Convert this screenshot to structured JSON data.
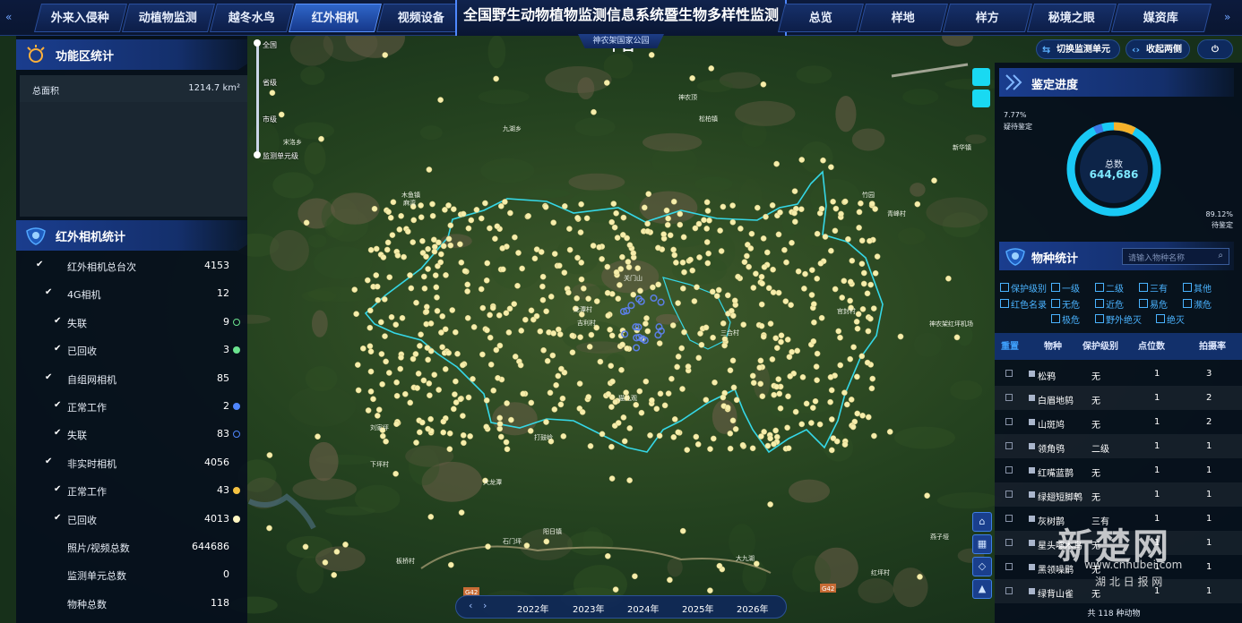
{
  "top_nav": {
    "left_tabs": [
      "外来入侵种",
      "动植物监测",
      "越冬水鸟",
      "红外相机",
      "视频设备"
    ],
    "right_tabs": [
      "总览",
      "样地",
      "样方",
      "秘境之眼",
      "媒资库"
    ],
    "active_tab": "红外相机",
    "title": "全国野生动物植物监测信息系统暨生物多样性监测平台",
    "subtitle": "神农架国家公园",
    "prev_icon": "double-chevron-left",
    "next_icon": "double-chevron-right"
  },
  "functional_zone": {
    "title": "功能区统计",
    "total_area_label": "总面积",
    "total_area_value": "1214.7 km²"
  },
  "camera_stats": {
    "title": "红外相机统计",
    "rows": [
      {
        "label": "红外相机总台次",
        "value": "4153",
        "checked": true,
        "indent": 0,
        "dot": ""
      },
      {
        "label": "4G相机",
        "value": "12",
        "checked": true,
        "indent": 1,
        "dot": ""
      },
      {
        "label": "失联",
        "value": "9",
        "checked": true,
        "indent": 2,
        "dot": "ring-green"
      },
      {
        "label": "已回收",
        "value": "3",
        "checked": true,
        "indent": 2,
        "dot": "green"
      },
      {
        "label": "自组网相机",
        "value": "85",
        "checked": true,
        "indent": 1,
        "dot": ""
      },
      {
        "label": "正常工作",
        "value": "2",
        "checked": true,
        "indent": 2,
        "dot": "blue"
      },
      {
        "label": "失联",
        "value": "83",
        "checked": true,
        "indent": 2,
        "dot": "ring-blue"
      },
      {
        "label": "非实时相机",
        "value": "4056",
        "checked": true,
        "indent": 1,
        "dot": ""
      },
      {
        "label": "正常工作",
        "value": "43",
        "checked": true,
        "indent": 2,
        "dot": "yellow"
      },
      {
        "label": "已回收",
        "value": "4013",
        "checked": true,
        "indent": 2,
        "dot": "cream"
      },
      {
        "label": "照片/视频总数",
        "value": "644686",
        "checked": false,
        "indent": 1,
        "dot": ""
      },
      {
        "label": "监测单元总数",
        "value": "0",
        "checked": false,
        "indent": 1,
        "dot": ""
      },
      {
        "label": "物种总数",
        "value": "118",
        "checked": false,
        "indent": 1,
        "dot": ""
      }
    ]
  },
  "zoom_levels": [
    "全国",
    "省级",
    "市级",
    "监测单元级"
  ],
  "map_labels": [
    "神农架红坪机场",
    "吉利村",
    "红坪村",
    "下坪村",
    "麻湾",
    "三合村",
    "石门坪",
    "打鼓岭",
    "新华镇",
    "竹园",
    "九湖乡",
    "木鱼镇",
    "宋洛乡",
    "阳日镇",
    "松柏镇",
    "板桥村",
    "青峰村",
    "神农顶",
    "大九湖",
    "刘家坪",
    "龙潭村",
    "官封村",
    "关门山",
    "猫儿观",
    "燕子垭",
    "大龙潭"
  ],
  "road_labels": [
    "G42",
    "G42"
  ],
  "right_buttons": {
    "switch_unit": "切换监测单元",
    "collapse": "收起两侧"
  },
  "identification": {
    "title": "鉴定进度",
    "pct_left": "7.77%",
    "pct_left_label": "疑待鉴定",
    "pct_right": "89.12%",
    "pct_right_label": "待鉴定",
    "total_label": "总数",
    "total_value": "644,686",
    "ring_color": "#19c9f5",
    "accent_color": "#f5b12a"
  },
  "species_stats": {
    "title": "物种统计",
    "search_placeholder": "请输入物种名称",
    "filters": [
      "保护级别",
      "一级",
      "二级",
      "三有",
      "其他",
      "红色名录",
      "无危",
      "近危",
      "易危",
      "濒危",
      "极危",
      "野外绝灭",
      "绝灭"
    ],
    "columns": [
      "重置",
      "物种",
      "保护级别",
      "点位数",
      "拍摄率"
    ],
    "rows": [
      {
        "name": "松鸦",
        "level": "无",
        "points": "1",
        "rate": "3"
      },
      {
        "name": "白眉地鸫",
        "level": "无",
        "points": "1",
        "rate": "2"
      },
      {
        "name": "山斑鸠",
        "level": "无",
        "points": "1",
        "rate": "2"
      },
      {
        "name": "领角鸮",
        "level": "二级",
        "points": "1",
        "rate": "1"
      },
      {
        "name": "红嘴蓝鹊",
        "level": "无",
        "points": "1",
        "rate": "1"
      },
      {
        "name": "绿翅短脚鹎",
        "level": "无",
        "points": "1",
        "rate": "1"
      },
      {
        "name": "灰树鹊",
        "level": "三有",
        "points": "1",
        "rate": "1"
      },
      {
        "name": "星头啄木鸟",
        "level": "无",
        "points": "1",
        "rate": "1"
      },
      {
        "name": "黑领噪鹛",
        "level": "无",
        "points": "1",
        "rate": "1"
      },
      {
        "name": "绿背山雀",
        "level": "无",
        "points": "1",
        "rate": "1"
      }
    ],
    "footer": "共 118 种动物"
  },
  "years": [
    "2022年",
    "2023年",
    "2024年",
    "2025年",
    "2026年"
  ],
  "watermark": {
    "brand": "新楚网",
    "domain": "www.cnhubei.com",
    "sub": "湖 北 日 报 网"
  }
}
